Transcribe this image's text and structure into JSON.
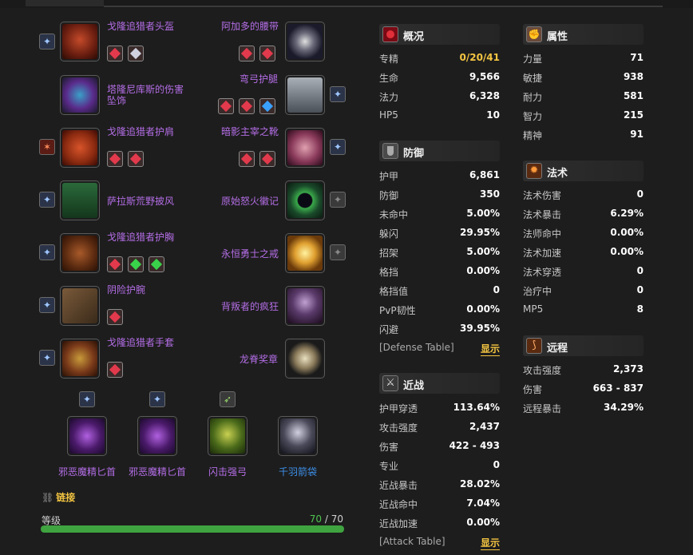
{
  "left_items": [
    {
      "name": "戈隆追猎者头盔"
    },
    {
      "name": "塔隆尼库斯的伤害坠饰"
    },
    {
      "name": "戈隆追猎者护肩"
    },
    {
      "name": "萨拉斯荒野披风"
    },
    {
      "name": "戈隆追猎者护胸"
    },
    {
      "name": "阴险护腕"
    },
    {
      "name": "戈隆追猎者手套"
    }
  ],
  "right_items": [
    {
      "name": "阿加多的腰带"
    },
    {
      "name": "弯弓护腿"
    },
    {
      "name": "暗影主宰之靴"
    },
    {
      "name": "原始怒火徽记"
    },
    {
      "name": "永恒勇士之戒"
    },
    {
      "name": "背叛者的疯狂"
    },
    {
      "name": "龙脊奖章"
    }
  ],
  "weapons": [
    {
      "name": "邪恶魔精匕首"
    },
    {
      "name": "邪恶魔精匕首"
    },
    {
      "name": "闪击强弓"
    },
    {
      "name": "千羽箭袋"
    }
  ],
  "link_label": "链接",
  "level": {
    "label": "等级",
    "current": "70",
    "sep": " / ",
    "max": "70",
    "fraction": 1.0
  },
  "overview": {
    "title": "概况",
    "rows": [
      {
        "label": "专精",
        "value": "0/20/41"
      },
      {
        "label": "生命",
        "value": "9,566"
      },
      {
        "label": "法力",
        "value": "6,328"
      },
      {
        "label": "HP5",
        "value": "10"
      }
    ]
  },
  "attributes": {
    "title": "属性",
    "rows": [
      {
        "label": "力量",
        "value": "71"
      },
      {
        "label": "敏捷",
        "value": "938"
      },
      {
        "label": "耐力",
        "value": "581"
      },
      {
        "label": "智力",
        "value": "215"
      },
      {
        "label": "精神",
        "value": "91"
      }
    ]
  },
  "defense": {
    "title": "防御",
    "rows": [
      {
        "label": "护甲",
        "value": "6,861"
      },
      {
        "label": "防御",
        "value": "350"
      },
      {
        "label": "未命中",
        "value": "5.00%"
      },
      {
        "label": "躲闪",
        "value": "29.95%"
      },
      {
        "label": "招架",
        "value": "5.00%"
      },
      {
        "label": "格挡",
        "value": "0.00%"
      },
      {
        "label": "格挡值",
        "value": "0"
      },
      {
        "label": "PvP韧性",
        "value": "0.00%"
      },
      {
        "label": "闪避",
        "value": "39.95%"
      }
    ],
    "table_label": "[Defense Table]",
    "show_label": "显示"
  },
  "spell": {
    "title": "法术",
    "rows": [
      {
        "label": "法术伤害",
        "value": "0"
      },
      {
        "label": "法术暴击",
        "value": "6.29%"
      },
      {
        "label": "法师命中",
        "value": "0.00%"
      },
      {
        "label": "法术加速",
        "value": "0.00%"
      },
      {
        "label": "法术穿透",
        "value": "0"
      },
      {
        "label": "治疗中",
        "value": "0"
      },
      {
        "label": "MP5",
        "value": "8"
      }
    ]
  },
  "melee": {
    "title": "近战",
    "rows": [
      {
        "label": "护甲穿透",
        "value": "113.64%"
      },
      {
        "label": "攻击强度",
        "value": "2,437"
      },
      {
        "label": "伤害",
        "value": "422 - 493"
      },
      {
        "label": "专业",
        "value": "0"
      },
      {
        "label": "近战暴击",
        "value": "28.02%"
      },
      {
        "label": "近战命中",
        "value": "7.04%"
      },
      {
        "label": "近战加速",
        "value": "0.00%"
      }
    ],
    "table_label": "[Attack Table]",
    "show_label": "显示"
  },
  "ranged": {
    "title": "远程",
    "rows": [
      {
        "label": "攻击强度",
        "value": "2,373"
      },
      {
        "label": "伤害",
        "value": "663 - 837"
      },
      {
        "label": "远程暴击",
        "value": "34.29%"
      }
    ]
  },
  "colors": {
    "accent_gold": "#f4c542",
    "epic_purple": "#b46ee6",
    "rare_blue": "#3d8fe8",
    "level_green": "#3fa33f"
  }
}
